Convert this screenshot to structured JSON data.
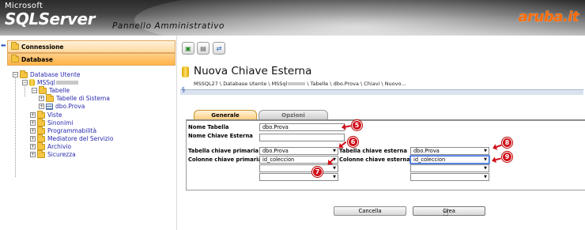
{
  "header": {
    "brand_small": "Microsoft",
    "brand_large": "SQLServer",
    "subtitle": "Pannello Amministrativo",
    "aruba_logo": "aruba.it"
  },
  "sidebar": {
    "sections": [
      {
        "label": "Connessione"
      },
      {
        "label": "Database"
      }
    ],
    "tree": {
      "root": "Database Utente",
      "db": "MSSql",
      "tables": "Tabelle",
      "sys_tables": "Tabelle di Sistema",
      "table": "dbo.Prova",
      "items": [
        "Viste",
        "Sinonimi",
        "Programmabilità",
        "Mediatore del Servizio",
        "Archivio",
        "Sicurezza"
      ]
    }
  },
  "main": {
    "title": "Nuova Chiave Esterna",
    "breadcrumb_start": "MSSQL27 \\ Database Utente \\ MSSql",
    "breadcrumb_end": " \\ Tabelle \\ dbo.Prova \\ Chiavi \\ Nuovo...",
    "tabs": [
      {
        "label": "Generale",
        "active": true
      },
      {
        "label": "Opzioni",
        "active": false
      }
    ],
    "form": {
      "nome_tabella_label": "Nome Tabella",
      "nome_tabella_value": "dbo.Prova",
      "nome_chiave_label": "Nome Chiave Esterna",
      "nome_chiave_value": "",
      "tab_primaria_label": "Tabella chiave primaria",
      "tab_primaria_value": "dbo.Prova",
      "col_primaria_label": "Colonne chiave primaria",
      "col_primaria_value": "id_coleccion",
      "tab_esterna_label": "Tabella chiave esterna",
      "tab_esterna_value": "dbo.Prova",
      "col_esterna_label": "Colonne chiave esterna",
      "col_esterna_value": "id_coleccion"
    },
    "buttons": {
      "cancel": "Cancella",
      "create": "Crea"
    },
    "annotations": [
      "5",
      "6",
      "7",
      "8",
      "9"
    ]
  },
  "colors": {
    "accent": "#ffb347",
    "annotation": "#d0101a",
    "link": "#2a2ab0"
  }
}
